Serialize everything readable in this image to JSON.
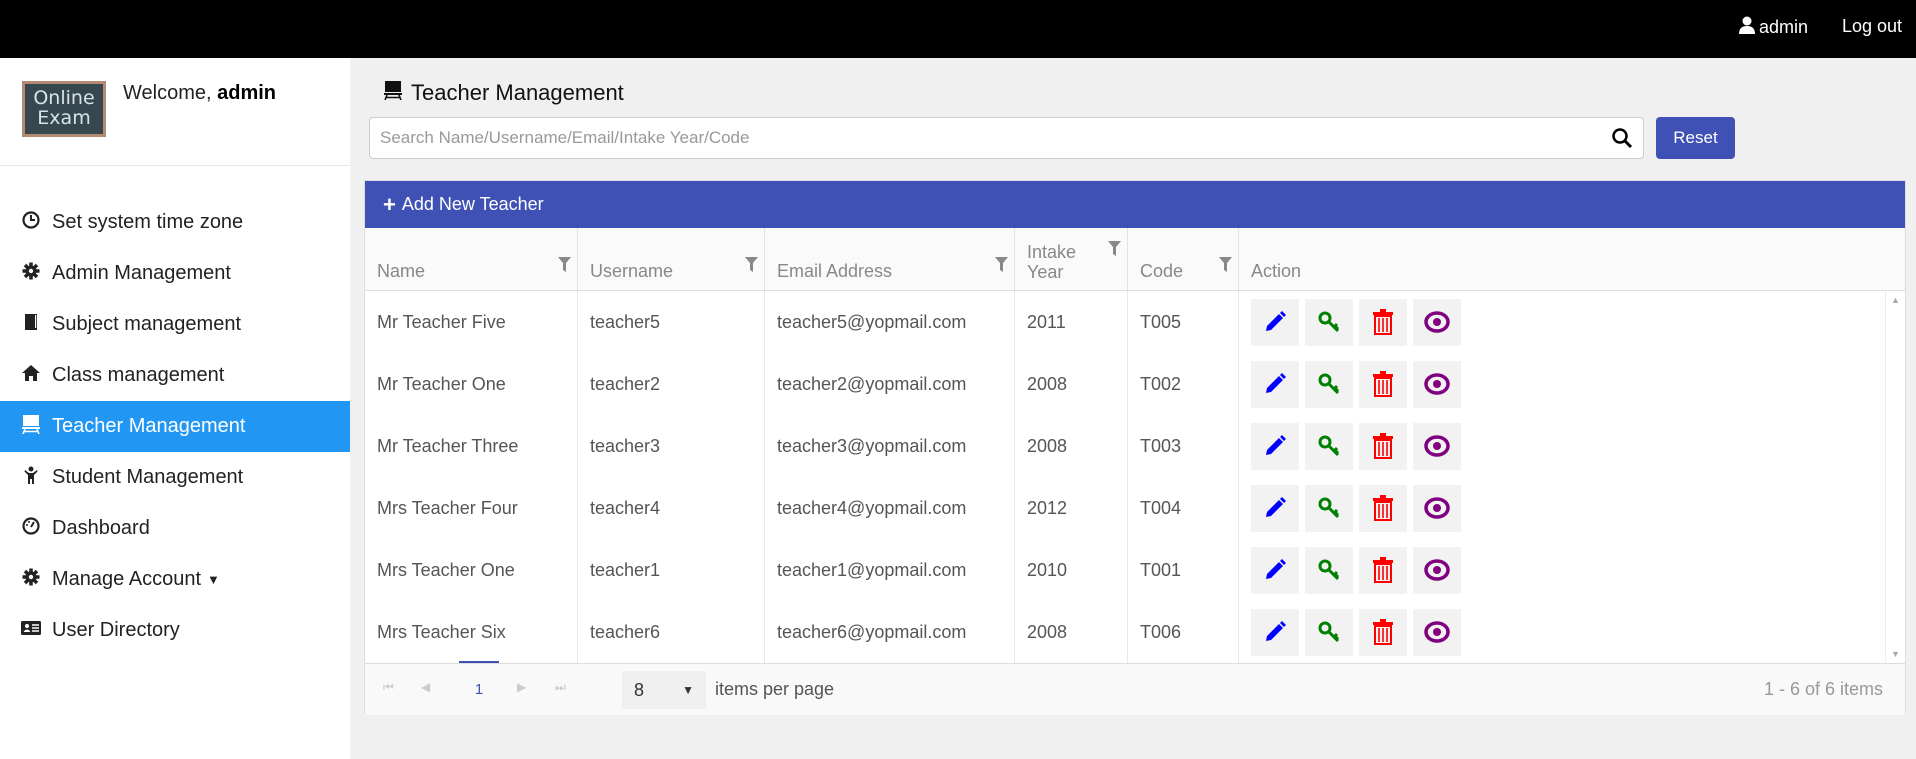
{
  "topbar": {
    "user": "admin",
    "logout": "Log out"
  },
  "sidebar": {
    "logo_text": "Online Exam",
    "welcome_prefix": "Welcome, ",
    "welcome_user": "admin",
    "items": [
      {
        "label": "Set system time zone",
        "icon": "clock-icon"
      },
      {
        "label": "Admin Management",
        "icon": "gear-icon"
      },
      {
        "label": "Subject management",
        "icon": "book-icon"
      },
      {
        "label": "Class management",
        "icon": "home-icon"
      },
      {
        "label": "Teacher Management",
        "icon": "blackboard-icon",
        "active": true
      },
      {
        "label": "Student Management",
        "icon": "child-icon"
      },
      {
        "label": "Dashboard",
        "icon": "dashboard-icon"
      },
      {
        "label": "Manage Account",
        "icon": "gear-icon",
        "caret": true
      },
      {
        "label": "User Directory",
        "icon": "id-card-icon"
      }
    ]
  },
  "main": {
    "title": "Teacher Management",
    "search_placeholder": "Search Name/Username/Email/Intake Year/Code",
    "reset": "Reset",
    "add_label": "Add New Teacher",
    "columns": [
      "Name",
      "Username",
      "Email Address",
      "Intake Year",
      "Code",
      "Action"
    ],
    "rows": [
      [
        "Mr Teacher Five",
        "teacher5",
        "teacher5@yopmail.com",
        "2011",
        "T005"
      ],
      [
        "Mr Teacher One",
        "teacher2",
        "teacher2@yopmail.com",
        "2008",
        "T002"
      ],
      [
        "Mr Teacher Three",
        "teacher3",
        "teacher3@yopmail.com",
        "2008",
        "T003"
      ],
      [
        "Mrs Teacher Four",
        "teacher4",
        "teacher4@yopmail.com",
        "2012",
        "T004"
      ],
      [
        "Mrs Teacher One",
        "teacher1",
        "teacher1@yopmail.com",
        "2010",
        "T001"
      ],
      [
        "Mrs Teacher Six",
        "teacher6",
        "teacher6@yopmail.com",
        "2008",
        "T006"
      ]
    ],
    "pager": {
      "page": "1",
      "page_size": "8",
      "per_label": "items per page",
      "count": "1 - 6 of 6 items"
    }
  },
  "colors": {
    "accent": "#3f51b5",
    "active": "#2196f3",
    "edit": "#0000ff",
    "key": "#008000",
    "delete": "#ff0000",
    "view": "#800080"
  }
}
